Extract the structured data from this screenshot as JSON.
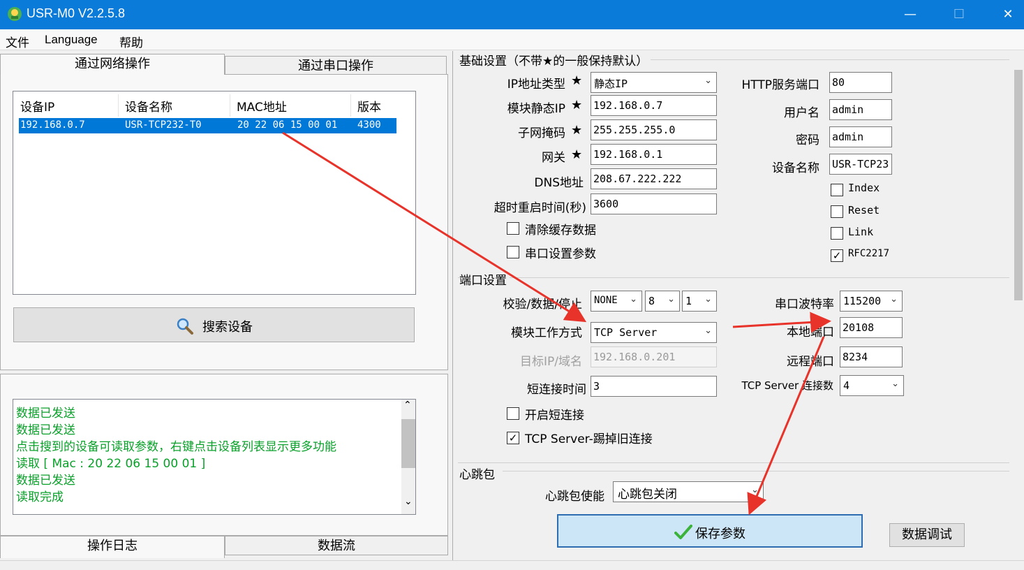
{
  "window": {
    "title": "USR-M0 V2.2.5.8",
    "minimize_glyph": "—",
    "maximize_glyph": "☐",
    "close_glyph": "✕"
  },
  "menu": {
    "items": [
      "文件",
      "Language",
      "帮助"
    ]
  },
  "left_tabs": {
    "network": "通过网络操作",
    "serial": "通过串口操作"
  },
  "device_table": {
    "headers": [
      "设备IP",
      "设备名称",
      "MAC地址",
      "版本"
    ],
    "rows": [
      {
        "ip": "192.168.0.7",
        "name": "USR-TCP232-T0",
        "mac": "20 22 06 15 00 01",
        "version": "4300"
      }
    ]
  },
  "search_button": "搜索设备",
  "log": {
    "lines": [
      "数据已发送",
      "数据已发送",
      "点击搜到的设备可读取参数，右键点击设备列表显示更多功能",
      "读取 [ Mac : 20 22 06 15 00 01 ]",
      "数据已发送",
      "读取完成"
    ],
    "scroll_up": "⌃",
    "scroll_down": "⌄"
  },
  "bottom_tabs": {
    "log": "操作日志",
    "stream": "数据流"
  },
  "basic": {
    "title": "基础设置（不带★的一般保持默认）",
    "star": "★",
    "ip_type_label": "IP地址类型",
    "ip_type_value": "静态IP",
    "static_ip_label": "模块静态IP",
    "static_ip_value": "192.168.0.7",
    "mask_label": "子网掩码",
    "mask_value": "255.255.255.0",
    "gateway_label": "网关",
    "gateway_value": "192.168.0.1",
    "dns_label": "DNS地址",
    "dns_value": "208.67.222.222",
    "timeout_label": "超时重启时间(秒)",
    "timeout_value": "3600",
    "clear_cache_label": "清除缓存数据",
    "serial_params_label": "串口设置参数",
    "http_port_label": "HTTP服务端口",
    "http_port_value": "80",
    "username_label": "用户名",
    "username_value": "admin",
    "password_label": "密码",
    "password_value": "admin",
    "device_name_label": "设备名称",
    "device_name_value": "USR-TCP23",
    "index_label": "Index",
    "reset_label": "Reset",
    "link_label": "Link",
    "rfc_label": "RFC2217"
  },
  "port": {
    "title": "端口设置",
    "parity_label": "校验/数据/停止",
    "parity_value": "NONE",
    "databits_value": "8",
    "stopbits_value": "1",
    "baud_label": "串口波特率",
    "baud_value": "115200",
    "mode_label": "模块工作方式",
    "mode_value": "TCP Server",
    "local_port_label": "本地端口",
    "local_port_value": "20108",
    "target_label": "目标IP/域名",
    "target_value": "192.168.0.201",
    "remote_port_label": "远程端口",
    "remote_port_value": "8234",
    "short_time_label": "短连接时间",
    "short_time_value": "3",
    "server_conn_label": "TCP Server 连接数",
    "server_conn_value": "4",
    "short_conn_label": "开启短连接",
    "kick_label": "TCP Server-踢掉旧连接"
  },
  "heartbeat": {
    "title": "心跳包",
    "enable_label": "心跳包使能",
    "enable_value": "心跳包关闭"
  },
  "buttons": {
    "save": "保存参数",
    "debug": "数据调试"
  },
  "checkbox_mark": "✓",
  "chevron": "⌄",
  "colors": {
    "titlebar": "#0a7bd8",
    "selection": "#0078d7",
    "log_text": "#0aa02a",
    "annotation_arrow": "#e8332a"
  }
}
